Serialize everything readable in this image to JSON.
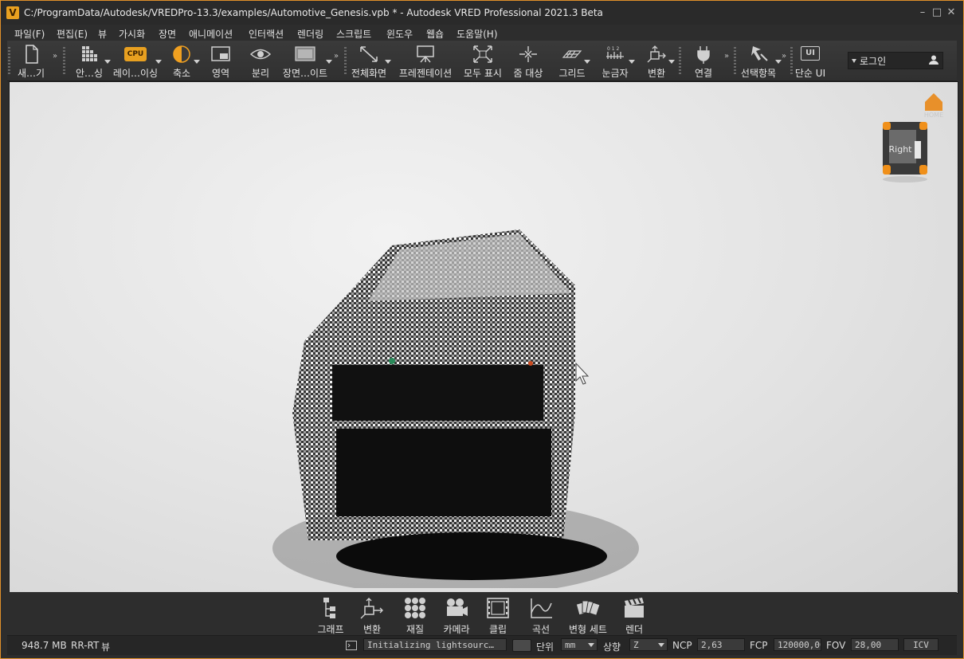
{
  "window": {
    "title": "C:/ProgramData/Autodesk/VREDPro-13.3/examples/Automotive_Genesis.vpb * - Autodesk VRED Professional 2021.3 Beta",
    "app_icon_letter": "V"
  },
  "menu": [
    "파일(F)",
    "편집(E)",
    "뷰",
    "가시화",
    "장면",
    "애니메이션",
    "인터랙션",
    "렌더링",
    "스크립트",
    "윈도우",
    "웹숍",
    "도움말(H)"
  ],
  "toolbar": {
    "items": [
      "새…기",
      "안…싱",
      "레이…이싱",
      "축소",
      "영역",
      "분리",
      "장면…이트",
      "전체화면",
      "프레젠테이션",
      "모두 표시",
      "줌 대상",
      "그리드",
      "눈금자",
      "변환",
      "연결",
      "선택항목",
      "단순 UI"
    ],
    "cpu_badge": "CPU",
    "ui_badge": "UI",
    "login_label": "로그인"
  },
  "viewport": {
    "navcube_face": "Right",
    "home_label": "HOME"
  },
  "modules": [
    "그래프",
    "변환",
    "재질",
    "카메라",
    "클립",
    "곡선",
    "변형 세트",
    "렌더"
  ],
  "status": {
    "memory": "948.7 MB",
    "renderer": "RR-RT",
    "view_label": "뷰",
    "log_message": "Initializing lightsourc…",
    "unit_label": "단위",
    "unit_value": "mm",
    "up_label": "상향",
    "up_value": "Z",
    "ncp_label": "NCP",
    "ncp_value": "2,63",
    "fcp_label": "FCP",
    "fcp_value": "120000,00",
    "fov_label": "FOV",
    "fov_value": "28,00",
    "icv_label": "ICV"
  },
  "colors": {
    "accent": "#e8a020",
    "frame": "#e0902a",
    "background": "#2d2d2d"
  }
}
